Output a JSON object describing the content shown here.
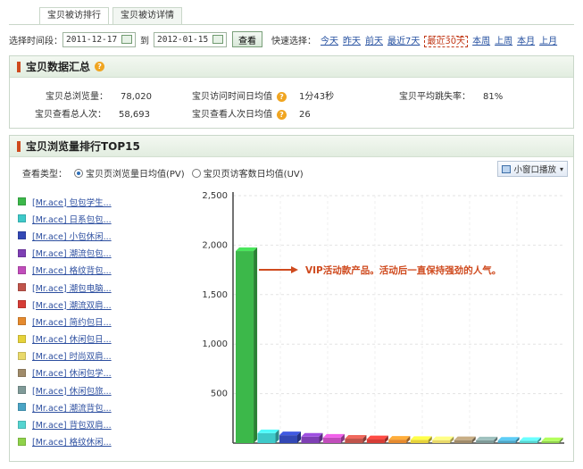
{
  "tabs": [
    {
      "label": "宝贝被访排行",
      "active": true
    },
    {
      "label": "宝贝被访详情",
      "active": false
    }
  ],
  "date_filter": {
    "label": "选择时间段：",
    "start": "2011-12-17",
    "to": "到",
    "end": "2012-01-15",
    "query_btn": "查看",
    "quick_label": "快速选择：",
    "quick": [
      "今天",
      "昨天",
      "前天",
      "最近7天",
      "最近30天",
      "本周",
      "上周",
      "本月",
      "上月"
    ],
    "quick_selected": "最近30天"
  },
  "summary": {
    "title": "宝贝数据汇总",
    "help": "?",
    "items": [
      {
        "label": "宝贝总浏览量：",
        "value": "78,020"
      },
      {
        "label": "宝贝查看总人次：",
        "value": "58,693"
      },
      {
        "label": "宝贝访问时间日均值",
        "value": "1分43秒"
      },
      {
        "label": "宝贝查看人次日均值",
        "value": "26"
      },
      {
        "label": "宝贝平均跳失率：",
        "value": "81%"
      }
    ]
  },
  "ranking": {
    "title": "宝贝浏览量排行TOP15",
    "view_type_label": "查看类型：",
    "view_options": [
      {
        "label": "宝贝页浏览量日均值(PV)",
        "selected": true
      },
      {
        "label": "宝贝页访客数日均值(UV)",
        "selected": false
      }
    ],
    "small_window_btn": "小窗口播放",
    "annotation": "VIP活动款产品。活动后一直保持强劲的人气。",
    "accent_color": "#cf4a1e"
  },
  "chart_data": {
    "type": "bar",
    "categories": [
      "[Mr.ace] 包包学生...",
      "[Mr.ace] 日系包包...",
      "[Mr.ace] 小包休闲...",
      "[Mr.ace] 潮流包包...",
      "[Mr.ace] 格纹背包...",
      "[Mr.ace] 潮包电脑...",
      "[Mr.ace] 潮流双肩...",
      "[Mr.ace] 简约包日...",
      "[Mr.ace] 休闲包日...",
      "[Mr.ace] 时尚双肩...",
      "[Mr.ace] 休闲包学...",
      "[Mr.ace] 休闲包旅...",
      "[Mr.ace] 潮流背包...",
      "[Mr.ace] 背包双肩...",
      "[Mr.ace] 格纹休闲..."
    ],
    "values": [
      1940,
      100,
      80,
      65,
      55,
      45,
      40,
      35,
      33,
      30,
      30,
      28,
      25,
      22,
      20
    ],
    "colors": [
      "#3cb84a",
      "#3ec9c9",
      "#3348b5",
      "#7e3fb4",
      "#c14dbb",
      "#c0544b",
      "#d63c36",
      "#e58a2e",
      "#e6d23a",
      "#e9d96a",
      "#a08b6a",
      "#7f9a98",
      "#4aa4c5",
      "#55d4d0",
      "#8fd24a"
    ],
    "yticks": [
      500,
      1000,
      1500,
      2000,
      2500
    ],
    "ytick_labels": [
      "500",
      "1,000",
      "1,500",
      "2,000",
      "2,500"
    ],
    "ylim": [
      0,
      2500
    ],
    "grid": true
  }
}
